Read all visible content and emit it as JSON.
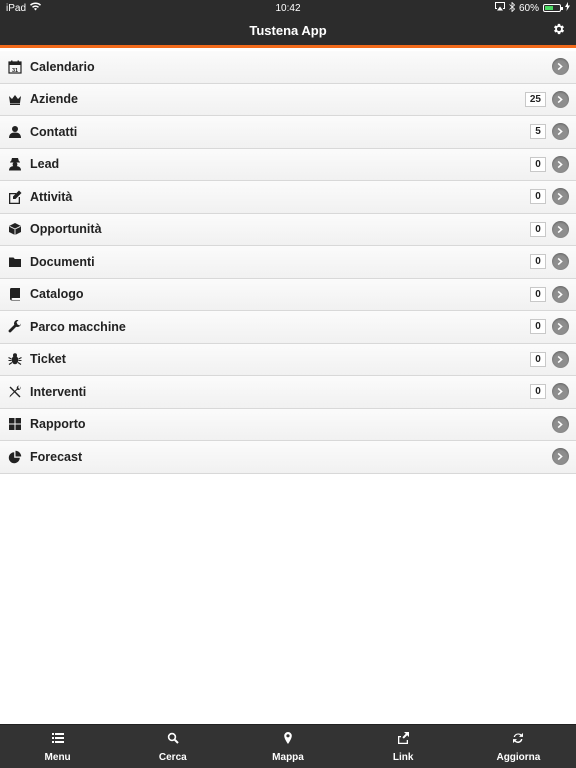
{
  "status": {
    "device": "iPad",
    "time": "10:42",
    "battery": "60%",
    "battery_level": 0.6,
    "battery_color": "#4cd964"
  },
  "nav": {
    "title": "Tustena App",
    "accent": "#f26a1b"
  },
  "menu": [
    {
      "label": "Calendario",
      "icon": "calendar-icon",
      "count": ""
    },
    {
      "label": "Aziende",
      "icon": "crown-icon",
      "count": "25"
    },
    {
      "label": "Contatti",
      "icon": "user-icon",
      "count": "5"
    },
    {
      "label": "Lead",
      "icon": "user-secret-icon",
      "count": "0"
    },
    {
      "label": "Attività",
      "icon": "edit-icon",
      "count": "0"
    },
    {
      "label": "Opportunità",
      "icon": "cube-icon",
      "count": "0"
    },
    {
      "label": "Documenti",
      "icon": "folder-icon",
      "count": "0"
    },
    {
      "label": "Catalogo",
      "icon": "book-icon",
      "count": "0"
    },
    {
      "label": "Parco macchine",
      "icon": "wrench-icon",
      "count": "0"
    },
    {
      "label": "Ticket",
      "icon": "bug-icon",
      "count": "0"
    },
    {
      "label": "Interventi",
      "icon": "tools-icon",
      "count": "0"
    },
    {
      "label": "Rapporto",
      "icon": "grid-icon",
      "count": ""
    },
    {
      "label": "Forecast",
      "icon": "pie-chart-icon",
      "count": ""
    }
  ],
  "calendar_day": "31",
  "tabs": [
    {
      "label": "Menu",
      "icon": "list-icon"
    },
    {
      "label": "Cerca",
      "icon": "search-icon"
    },
    {
      "label": "Mappa",
      "icon": "map-pin-icon"
    },
    {
      "label": "Link",
      "icon": "share-icon"
    },
    {
      "label": "Aggiorna",
      "icon": "refresh-icon"
    }
  ]
}
